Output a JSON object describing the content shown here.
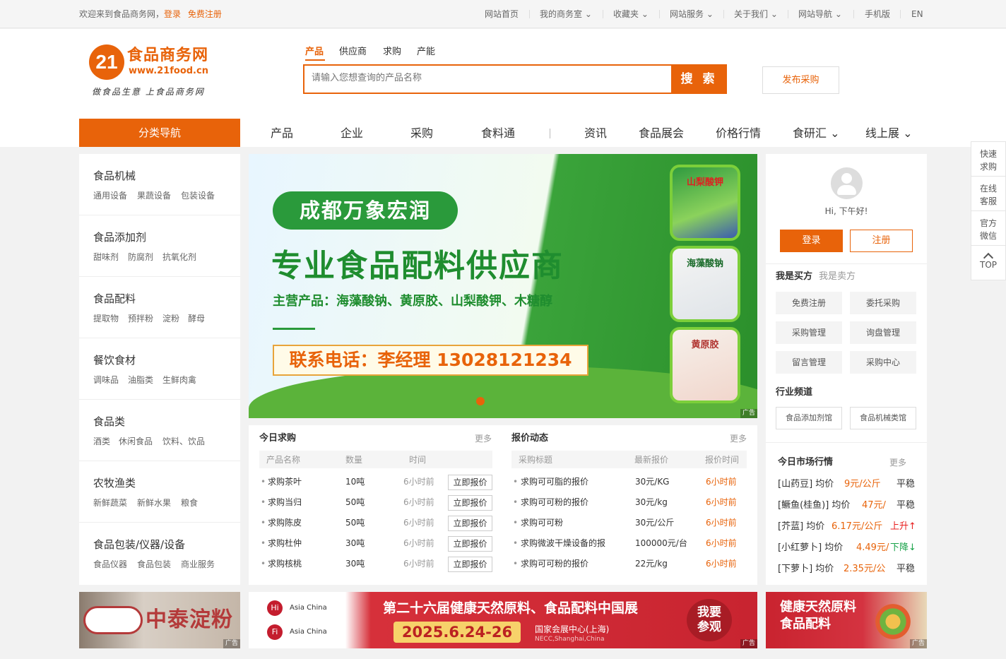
{
  "topbar": {
    "welcome": "欢迎来到食品商务网，",
    "login": "登录",
    "register": "免费注册",
    "links": [
      "网站首页",
      "我的商务室 ⌄",
      "收藏夹 ⌄",
      "网站服务 ⌄",
      "关于我们 ⌄",
      "网站导航 ⌄",
      "手机版",
      "EN"
    ]
  },
  "logo": {
    "mark": "21",
    "name": "食品商务网",
    "url": "www.21food.cn",
    "slogan": "做食品生意 上食品商务网"
  },
  "search": {
    "tabs": [
      "产品",
      "供应商",
      "求购",
      "产能"
    ],
    "placeholder": "请输入您想查询的产品名称",
    "button": "搜 索",
    "post_button": "发布采购"
  },
  "mainnav": {
    "category_label": "分类导航",
    "items": [
      "产品",
      "企业",
      "采购",
      "食料通",
      "资讯",
      "食品展会",
      "价格行情",
      "食研汇 ⌄",
      "线上展 ⌄"
    ]
  },
  "categories": [
    {
      "title": "食品机械",
      "subs": [
        "通用设备",
        "果蔬设备",
        "包装设备"
      ]
    },
    {
      "title": "食品添加剂",
      "subs": [
        "甜味剂",
        "防腐剂",
        "抗氧化剂"
      ]
    },
    {
      "title": "食品配料",
      "subs": [
        "提取物",
        "预拌粉",
        "淀粉",
        "酵母"
      ]
    },
    {
      "title": "餐饮食材",
      "subs": [
        "调味品",
        "油脂类",
        "生鲜肉禽"
      ]
    },
    {
      "title": "食品类",
      "subs": [
        "酒类",
        "休闲食品",
        "饮料、饮品"
      ]
    },
    {
      "title": "农牧渔类",
      "subs": [
        "新鲜蔬菜",
        "新鲜水果",
        "粮食"
      ]
    },
    {
      "title": "食品包装/仪器/设备",
      "subs": [
        "食品仪器",
        "食品包装",
        "商业服务"
      ]
    }
  ],
  "banner": {
    "company": "成都万象宏润",
    "headline": "专业食品配料供应商",
    "products": "主营产品：海藻酸钠、黄原胶、山梨酸钾、木糖醇",
    "phone": "联系电话：李经理 13028121234",
    "bags": [
      "山梨酸钾",
      "海藻酸钠",
      "黄原胶"
    ],
    "ad": "广告"
  },
  "user": {
    "greeting": "Hi, 下午好!",
    "login": "登录",
    "register": "注册",
    "tabs": [
      "我是买方",
      "我是卖方"
    ],
    "buttons": [
      "免费注册",
      "委托采购",
      "采购管理",
      "询盘管理",
      "留言管理",
      "采购中心"
    ],
    "channel_title": "行业频道",
    "channels": [
      "食品添加剂馆",
      "食品机械类馆"
    ]
  },
  "purchase": {
    "title": "今日求购",
    "more": "更多",
    "headers": [
      "产品名称",
      "数量",
      "时间"
    ],
    "rows": [
      {
        "name": "求购茶叶",
        "qty": "10吨",
        "time": "6小时前",
        "action": "立即报价"
      },
      {
        "name": "求购当归",
        "qty": "50吨",
        "time": "6小时前",
        "action": "立即报价"
      },
      {
        "name": "求购陈皮",
        "qty": "50吨",
        "time": "6小时前",
        "action": "立即报价"
      },
      {
        "name": "求购杜仲",
        "qty": "30吨",
        "time": "6小时前",
        "action": "立即报价"
      },
      {
        "name": "求购核桃",
        "qty": "30吨",
        "time": "6小时前",
        "action": "立即报价"
      }
    ]
  },
  "quotes": {
    "title": "报价动态",
    "more": "更多",
    "headers": [
      "采购标题",
      "最新报价",
      "报价时间"
    ],
    "rows": [
      {
        "name": "求购可可脂的报价",
        "price": "30元/KG",
        "time": "6小时前"
      },
      {
        "name": "求购可可粉的报价",
        "price": "30元/kg",
        "time": "6小时前"
      },
      {
        "name": "求购可可粉",
        "price": "30元/公斤",
        "time": "6小时前"
      },
      {
        "name": "求购微波干燥设备的报",
        "price": "100000元/台",
        "time": "6小时前"
      },
      {
        "name": "求购可可粉的报价",
        "price": "22元/kg",
        "time": "6小时前"
      }
    ]
  },
  "market": {
    "title": "今日市场行情",
    "more": "更多",
    "rows": [
      {
        "name": "[山药豆] 均价",
        "price": "9元/公斤",
        "trend": "平稳"
      },
      {
        "name": "[鳜鱼(桂鱼)] 均价",
        "price": "47元/",
        "trend": "平稳"
      },
      {
        "name": "[芥蓝] 均价",
        "price": "6.17元/公斤",
        "trend": "上升↑"
      },
      {
        "name": "[小红萝卜] 均价",
        "price": "4.49元/",
        "trend": "下降↓"
      },
      {
        "name": "[下萝卜] 均价",
        "price": "2.35元/公",
        "trend": "平稳"
      }
    ]
  },
  "side": [
    "快速\n求购",
    "在线\n客服",
    "官方\n微信",
    "TOP"
  ],
  "ads": {
    "left": "中泰淀粉",
    "mid_logo1": "Asia China",
    "mid_logo2": "Asia China",
    "mid_title": "第二十六届健康天然原料、食品配料中国展",
    "mid_date": "2025.6.24-26",
    "mid_venue": "国家会展中心(上海)",
    "mid_venue_en": "NECC,Shanghai,China",
    "mid_cta": "我要参观",
    "right": "健康天然原料\n食品配料",
    "ad": "广告"
  },
  "colors": {
    "accent": "#e8630a",
    "green": "#1f8d2f",
    "red": "#d6303a"
  }
}
